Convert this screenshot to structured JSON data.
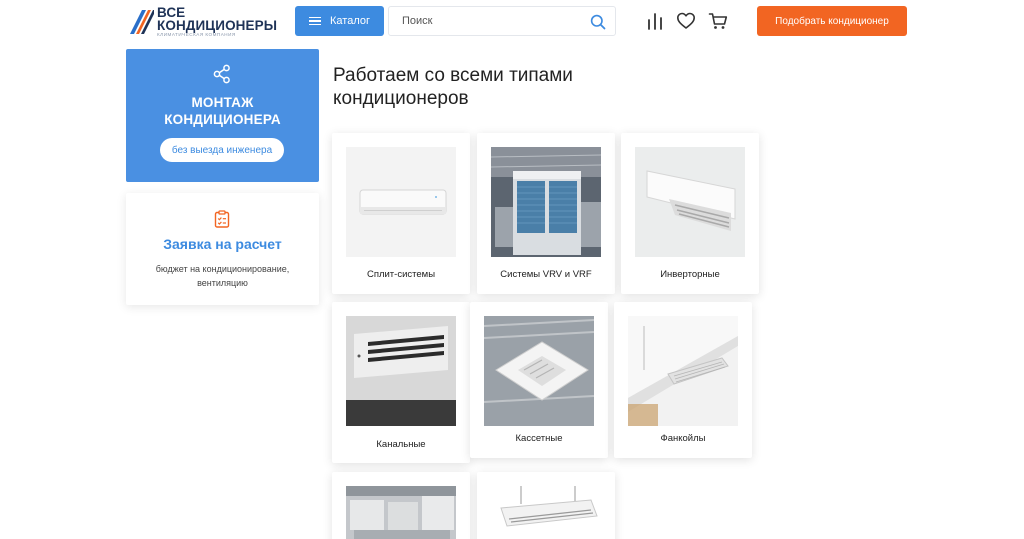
{
  "header": {
    "logo_line1": "ВСЕ",
    "logo_line2": "КОНДИЦИОНЕРЫ",
    "logo_tagline": "КЛИМАТИЧЕСКАЯ КОМПАНИЯ",
    "catalog_label": "Каталог",
    "search_placeholder": "Поиск",
    "cta_label": "Подобрать кондиционер",
    "icons": [
      "compare-icon",
      "heart-icon",
      "cart-icon"
    ]
  },
  "sidebar": {
    "promo_title_line1": "МОНТАЖ",
    "promo_title_line2": "КОНДИЦИОНЕРА",
    "promo_button": "без выезда инженера",
    "request_title": "Заявка на расчет",
    "request_text": "бюджет на кондиционирование, вентиляцию"
  },
  "main": {
    "title_line1": "Работаем со всеми типами",
    "title_line2": "кондиционеров",
    "cards": [
      {
        "label": "Сплит-системы"
      },
      {
        "label": "Системы VRV и VRF"
      },
      {
        "label": "Инверторные"
      },
      {
        "label": "Канальные"
      },
      {
        "label": "Кассетные"
      },
      {
        "label": "Фанкойлы"
      },
      {
        "label": ""
      },
      {
        "label": ""
      }
    ]
  },
  "colors": {
    "accent_blue": "#3d8be0",
    "promo_blue": "#4a90e2",
    "cta_orange": "#f26522",
    "logo_navy": "#1f3357"
  }
}
